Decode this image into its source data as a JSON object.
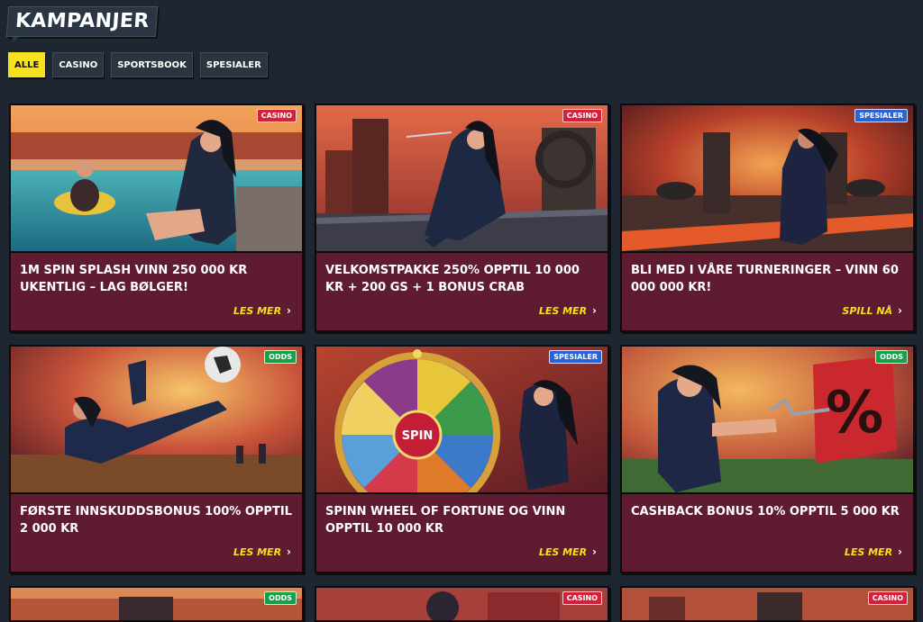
{
  "page": {
    "title": "KAMPANJER"
  },
  "filters": [
    {
      "label": "ALLE",
      "active": true
    },
    {
      "label": "CASINO",
      "active": false
    },
    {
      "label": "SPORTSBOOK",
      "active": false
    },
    {
      "label": "SPESIALER",
      "active": false
    }
  ],
  "colors": {
    "accent_yellow": "#f6e11a",
    "card_bg": "#5f1b30",
    "casino_badge": "#d3213a",
    "spesialer_badge": "#2763d9",
    "odds_badge": "#16a04b"
  },
  "promotions": [
    {
      "badge": "CASINO",
      "title": "1M SPIN SPLASH VINN 250 000 KR UKENTLIG – LAG BØLGER!",
      "cta": "LES MER",
      "icon": "pool-character-image"
    },
    {
      "badge": "CASINO",
      "title": "VELKOMSTPAKKE 250% OPPTIL 10 000 KR + 200 GS + 1 BONUS CRAB",
      "cta": "LES MER",
      "icon": "rooftop-ninja-image"
    },
    {
      "badge": "SPESIALER",
      "title": "BLI MED I VÅRE TURNERINGER – VINN 60 000 000 KR!",
      "cta": "SPILL NÅ",
      "icon": "fire-arena-image"
    },
    {
      "badge": "ODDS",
      "title": "FØRSTE INNSKUDDSBONUS 100% OPPTIL 2 000 KR",
      "cta": "LES MER",
      "icon": "football-kick-image"
    },
    {
      "badge": "SPESIALER",
      "title": "SPINN WHEEL OF FORTUNE OG VINN OPPTIL 10 000 KR",
      "cta": "LES MER",
      "icon": "spin-wheel-image",
      "wheel_label": "SPIN"
    },
    {
      "badge": "ODDS",
      "title": "CASHBACK BONUS 10% OPPTIL 5 000 KR",
      "cta": "LES MER",
      "icon": "cashback-percent-image",
      "sign_label": "%"
    },
    {
      "badge": "ODDS",
      "title": "",
      "cta": "",
      "icon": "partial-image"
    },
    {
      "badge": "CASINO",
      "title": "",
      "cta": "",
      "icon": "partial-image"
    },
    {
      "badge": "CASINO",
      "title": "",
      "cta": "",
      "icon": "partial-image"
    }
  ]
}
